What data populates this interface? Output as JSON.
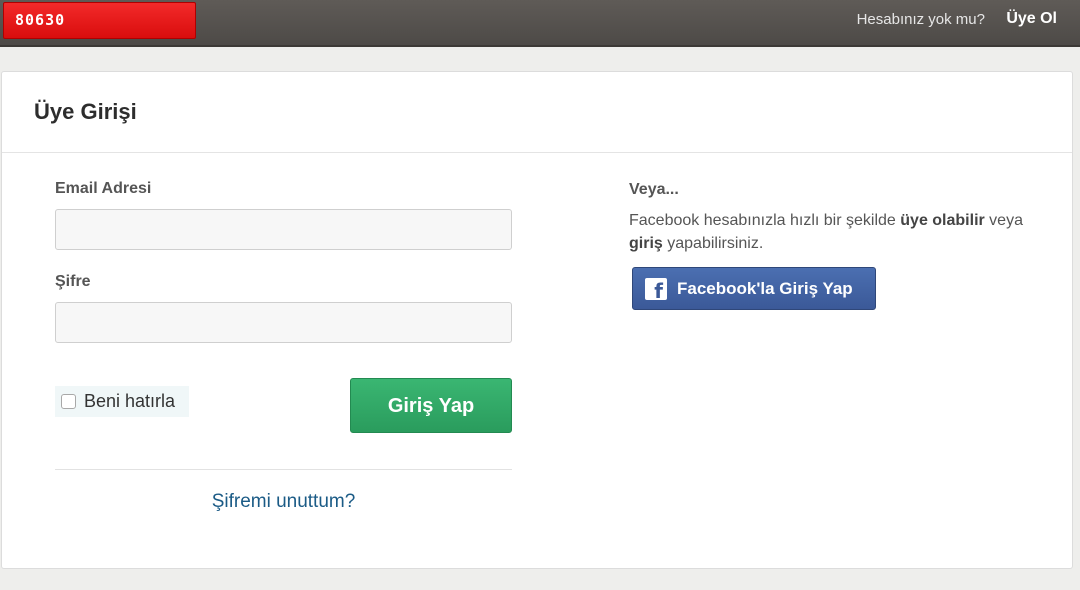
{
  "topbar": {
    "logo_text": "80630",
    "question": "Hesabınız yok mu?",
    "signup_link": "Üye Ol"
  },
  "card": {
    "title": "Üye Girişi"
  },
  "form": {
    "email_label": "Email Adresi",
    "email_value": "",
    "password_label": "Şifre",
    "password_value": "",
    "remember_label": "Beni hatırla",
    "remember_checked": false,
    "submit_label": "Giriş Yap",
    "forgot_link": "Şifremi unuttum?"
  },
  "social": {
    "heading": "Veya...",
    "desc_part1": "Facebook hesabınızla hızlı bir şekilde ",
    "desc_bold1": "üye olabilir",
    "desc_part2": " veya ",
    "desc_bold2": "giriş",
    "desc_part3": " yapabilirsiniz.",
    "facebook_button": "Facebook'la Giriş Yap",
    "facebook_icon_glyph": "f"
  },
  "colors": {
    "topbar": "#565250",
    "logo": "#e81a1a",
    "login_button": "#2fa865",
    "facebook_button": "#3b5998",
    "link": "#1b5b86"
  },
  "icons": {
    "facebook": "facebook-icon",
    "checkbox": "checkbox-icon"
  }
}
